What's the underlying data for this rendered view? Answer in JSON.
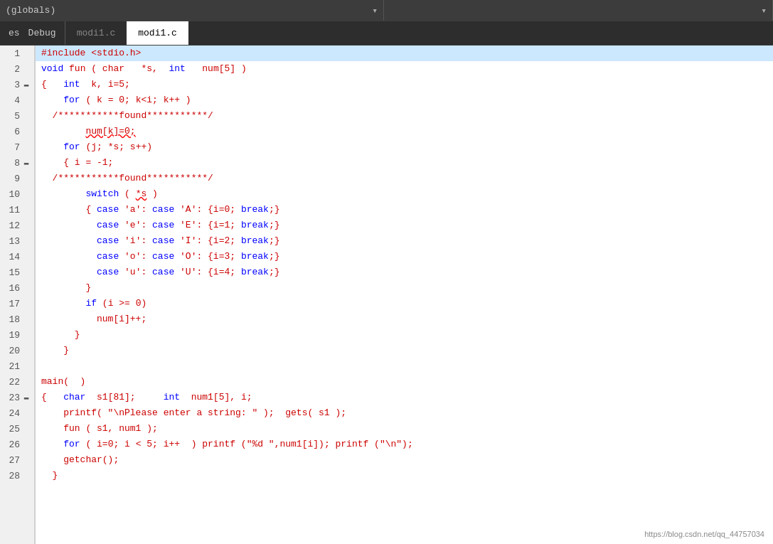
{
  "topbar": {
    "left_dropdown_label": "(globals)",
    "right_dropdown_label": ""
  },
  "tabs": {
    "left_items": [
      "es",
      "Debug"
    ],
    "tab1": "modi1.c",
    "tab2": "modi1.c"
  },
  "watermark": "https://blog.csdn.net/qq_44757034",
  "lines": [
    {
      "num": 1,
      "collapse": false,
      "text": "#include <stdio.h>",
      "highlight": true
    },
    {
      "num": 2,
      "collapse": false,
      "text": "void fun ( char   *s,  int   num[5] )"
    },
    {
      "num": 3,
      "collapse": true,
      "text": "{   int  k, i=5;"
    },
    {
      "num": 4,
      "collapse": false,
      "text": "    for ( k = 0; k<i; k++ )"
    },
    {
      "num": 5,
      "collapse": false,
      "text": "  /***********found***********/"
    },
    {
      "num": 6,
      "collapse": false,
      "text": "        num[k]=0;"
    },
    {
      "num": 7,
      "collapse": false,
      "text": "    for (j; *s; s++)"
    },
    {
      "num": 8,
      "collapse": true,
      "text": "    { i = -1;"
    },
    {
      "num": 9,
      "collapse": false,
      "text": "  /***********found***********/"
    },
    {
      "num": 10,
      "collapse": false,
      "text": "        switch ( *s )"
    },
    {
      "num": 11,
      "collapse": false,
      "text": "        { case 'a': case 'A': {i=0; break;}"
    },
    {
      "num": 12,
      "collapse": false,
      "text": "          case 'e': case 'E': {i=1; break;}"
    },
    {
      "num": 13,
      "collapse": false,
      "text": "          case 'i': case 'I': {i=2; break;}"
    },
    {
      "num": 14,
      "collapse": false,
      "text": "          case 'o': case 'O': {i=3; break;}"
    },
    {
      "num": 15,
      "collapse": false,
      "text": "          case 'u': case 'U': {i=4; break;}"
    },
    {
      "num": 16,
      "collapse": false,
      "text": "        }"
    },
    {
      "num": 17,
      "collapse": false,
      "text": "        if (i >= 0)"
    },
    {
      "num": 18,
      "collapse": false,
      "text": "          num[i]++;"
    },
    {
      "num": 19,
      "collapse": false,
      "text": "      }"
    },
    {
      "num": 20,
      "collapse": false,
      "text": "    }"
    },
    {
      "num": 21,
      "collapse": false,
      "text": ""
    },
    {
      "num": 22,
      "collapse": false,
      "text": "main(  )"
    },
    {
      "num": 23,
      "collapse": true,
      "text": "{   char  s1[81];     int  num1[5], i;"
    },
    {
      "num": 24,
      "collapse": false,
      "text": "    printf( \"\\nPlease enter a string: \" );  gets( s1 );"
    },
    {
      "num": 25,
      "collapse": false,
      "text": "    fun ( s1, num1 );"
    },
    {
      "num": 26,
      "collapse": false,
      "text": "    for ( i=0; i < 5; i++  ) printf (\"%d \",num1[i]); printf (\"\\n\");"
    },
    {
      "num": 27,
      "collapse": false,
      "text": "    getchar();"
    },
    {
      "num": 28,
      "collapse": false,
      "text": "  }"
    }
  ]
}
